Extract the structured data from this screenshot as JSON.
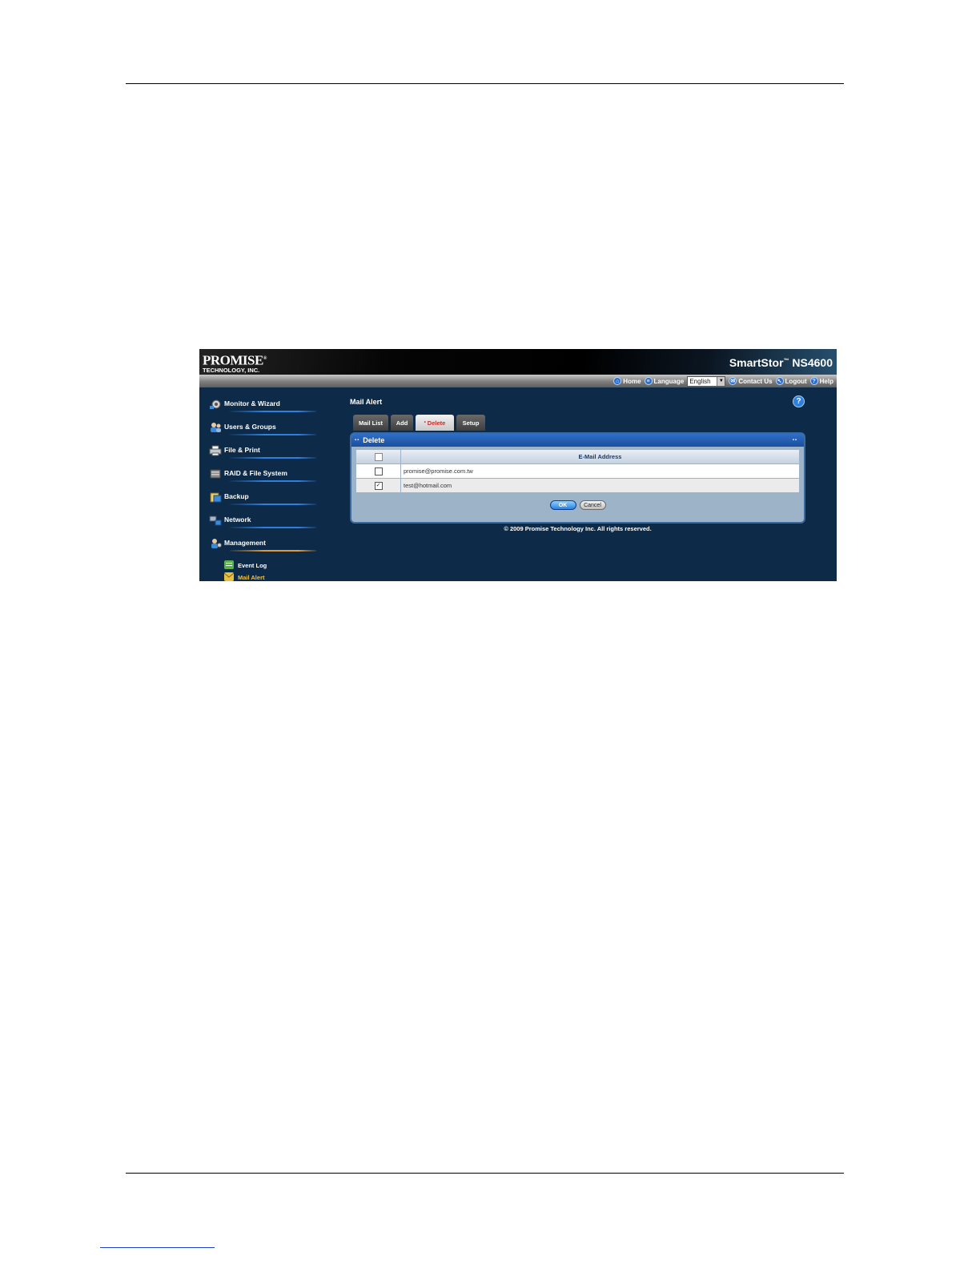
{
  "app": {
    "logo_line1": "PROMISE",
    "logo_reg": "®",
    "logo_line2": "TECHNOLOGY, INC.",
    "product_name": "SmartStor",
    "product_tm": "™",
    "product_model": " NS4600"
  },
  "topnav": {
    "home": "Home",
    "language": "Language",
    "language_value": "English",
    "contact": "Contact Us",
    "logout": "Logout",
    "help": "Help"
  },
  "sidebar": {
    "items": [
      {
        "label": "Monitor & Wizard"
      },
      {
        "label": "Users & Groups"
      },
      {
        "label": "File & Print"
      },
      {
        "label": "RAID & File System"
      },
      {
        "label": "Backup"
      },
      {
        "label": "Network"
      },
      {
        "label": "Management"
      }
    ],
    "subitems": [
      {
        "label": "Event Log"
      },
      {
        "label": "Mail Alert"
      }
    ]
  },
  "main": {
    "title": "Mail Alert",
    "help_glyph": "?",
    "tabs": [
      {
        "label": "Mail List"
      },
      {
        "label": "Add"
      },
      {
        "label": "Delete"
      },
      {
        "label": "Setup"
      }
    ],
    "panel": {
      "title": "Delete",
      "column_header": "E-Mail Address",
      "rows": [
        {
          "email": "promise@promise.com.tw",
          "checked": false
        },
        {
          "email": "test@hotmail.com",
          "checked": true
        }
      ],
      "ok_label": "OK",
      "cancel_label": "Cancel"
    },
    "copyright": "© 2009 Promise Technology Inc. All rights reserved."
  },
  "colors": {
    "background": "#0d2a48",
    "accent_blue": "#2f7fdc",
    "active_tab_text": "#c03030",
    "active_nav_text": "#f0c040"
  }
}
